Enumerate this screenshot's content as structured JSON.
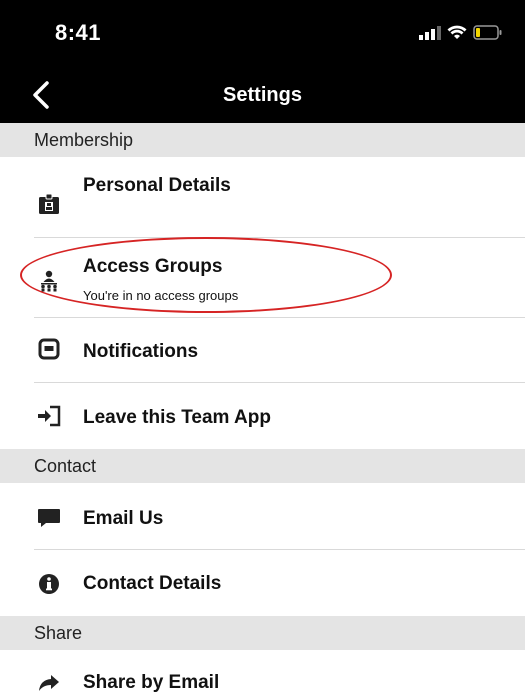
{
  "status_bar": {
    "time": "8:41"
  },
  "nav": {
    "title": "Settings"
  },
  "sections": {
    "membership": "Membership",
    "contact": "Contact",
    "share": "Share"
  },
  "membership_items": {
    "personal_details": "Personal Details",
    "access_groups": "Access Groups",
    "access_groups_subtitle": "You're in no access groups",
    "notifications": "Notifications",
    "leave_team_app": "Leave this Team App"
  },
  "contact_items": {
    "email_us": "Email Us",
    "contact_details": "Contact Details"
  },
  "share_items": {
    "share_by_email": "Share by Email"
  },
  "colors": {
    "bar_background": "#000000",
    "section_background": "#e4e4e4",
    "annotation": "#d62424"
  }
}
